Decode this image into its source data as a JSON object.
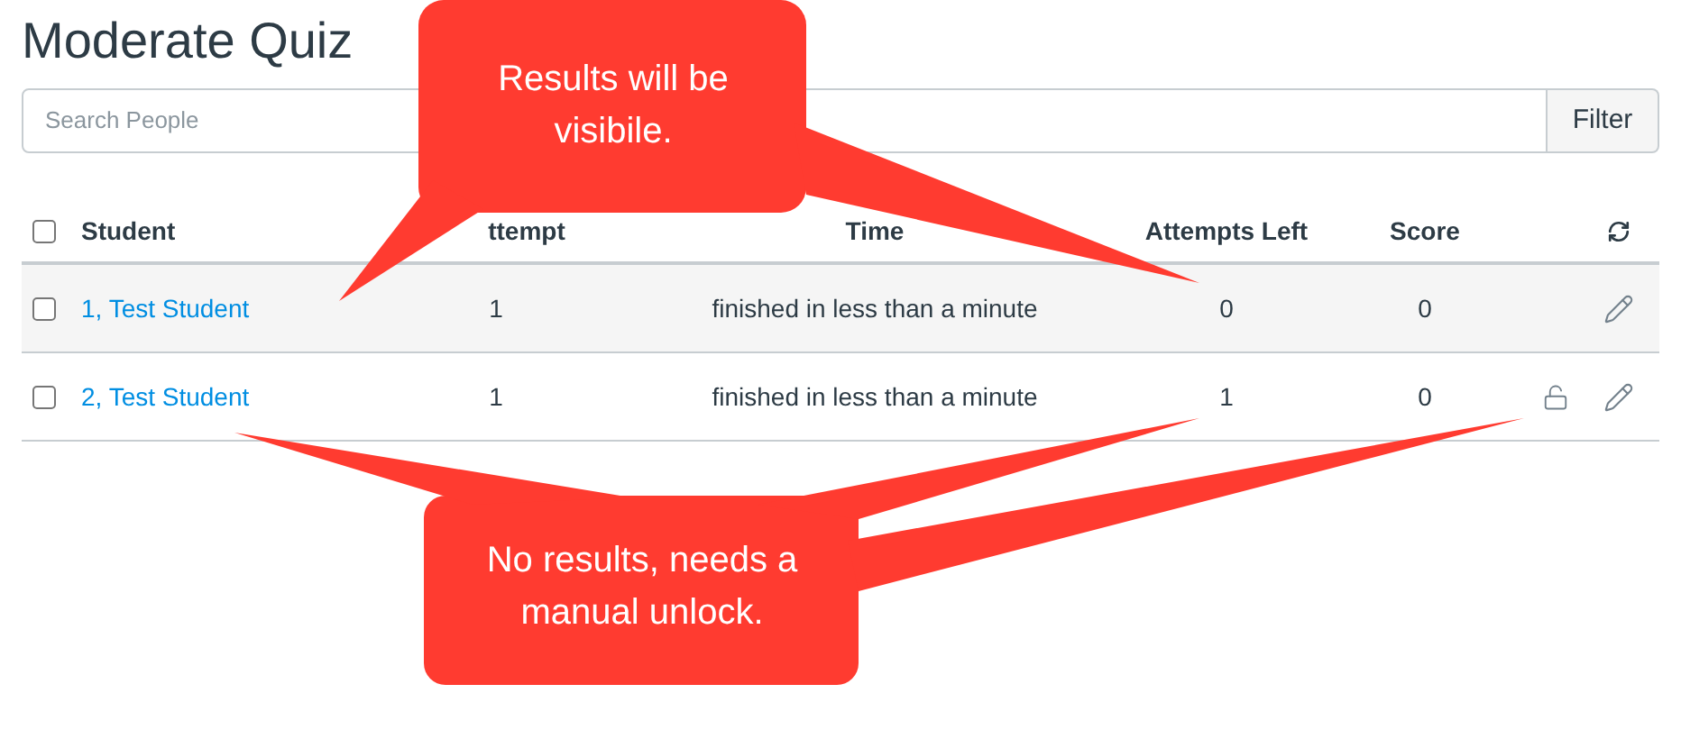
{
  "title": "Moderate Quiz",
  "search": {
    "placeholder": "Search People"
  },
  "filter_button": "Filter",
  "table": {
    "select_all": {
      "checked": false
    },
    "columns": [
      "Student",
      "ttempt",
      "Time",
      "Attempts Left",
      "Score"
    ],
    "rows": [
      {
        "selected": true,
        "checked": false,
        "student": "1, Test Student",
        "attempt": "1",
        "time": "finished in less than a minute",
        "attempts_left": "0",
        "score": "0",
        "locked": false
      },
      {
        "selected": false,
        "checked": false,
        "student": "2, Test Student",
        "attempt": "1",
        "time": "finished in less than a minute",
        "attempts_left": "1",
        "score": "0",
        "locked": true
      }
    ]
  },
  "callouts": [
    {
      "lines": [
        "Results will be",
        "visibile."
      ]
    },
    {
      "lines": [
        "No results, needs a",
        "manual unlock."
      ]
    }
  ]
}
